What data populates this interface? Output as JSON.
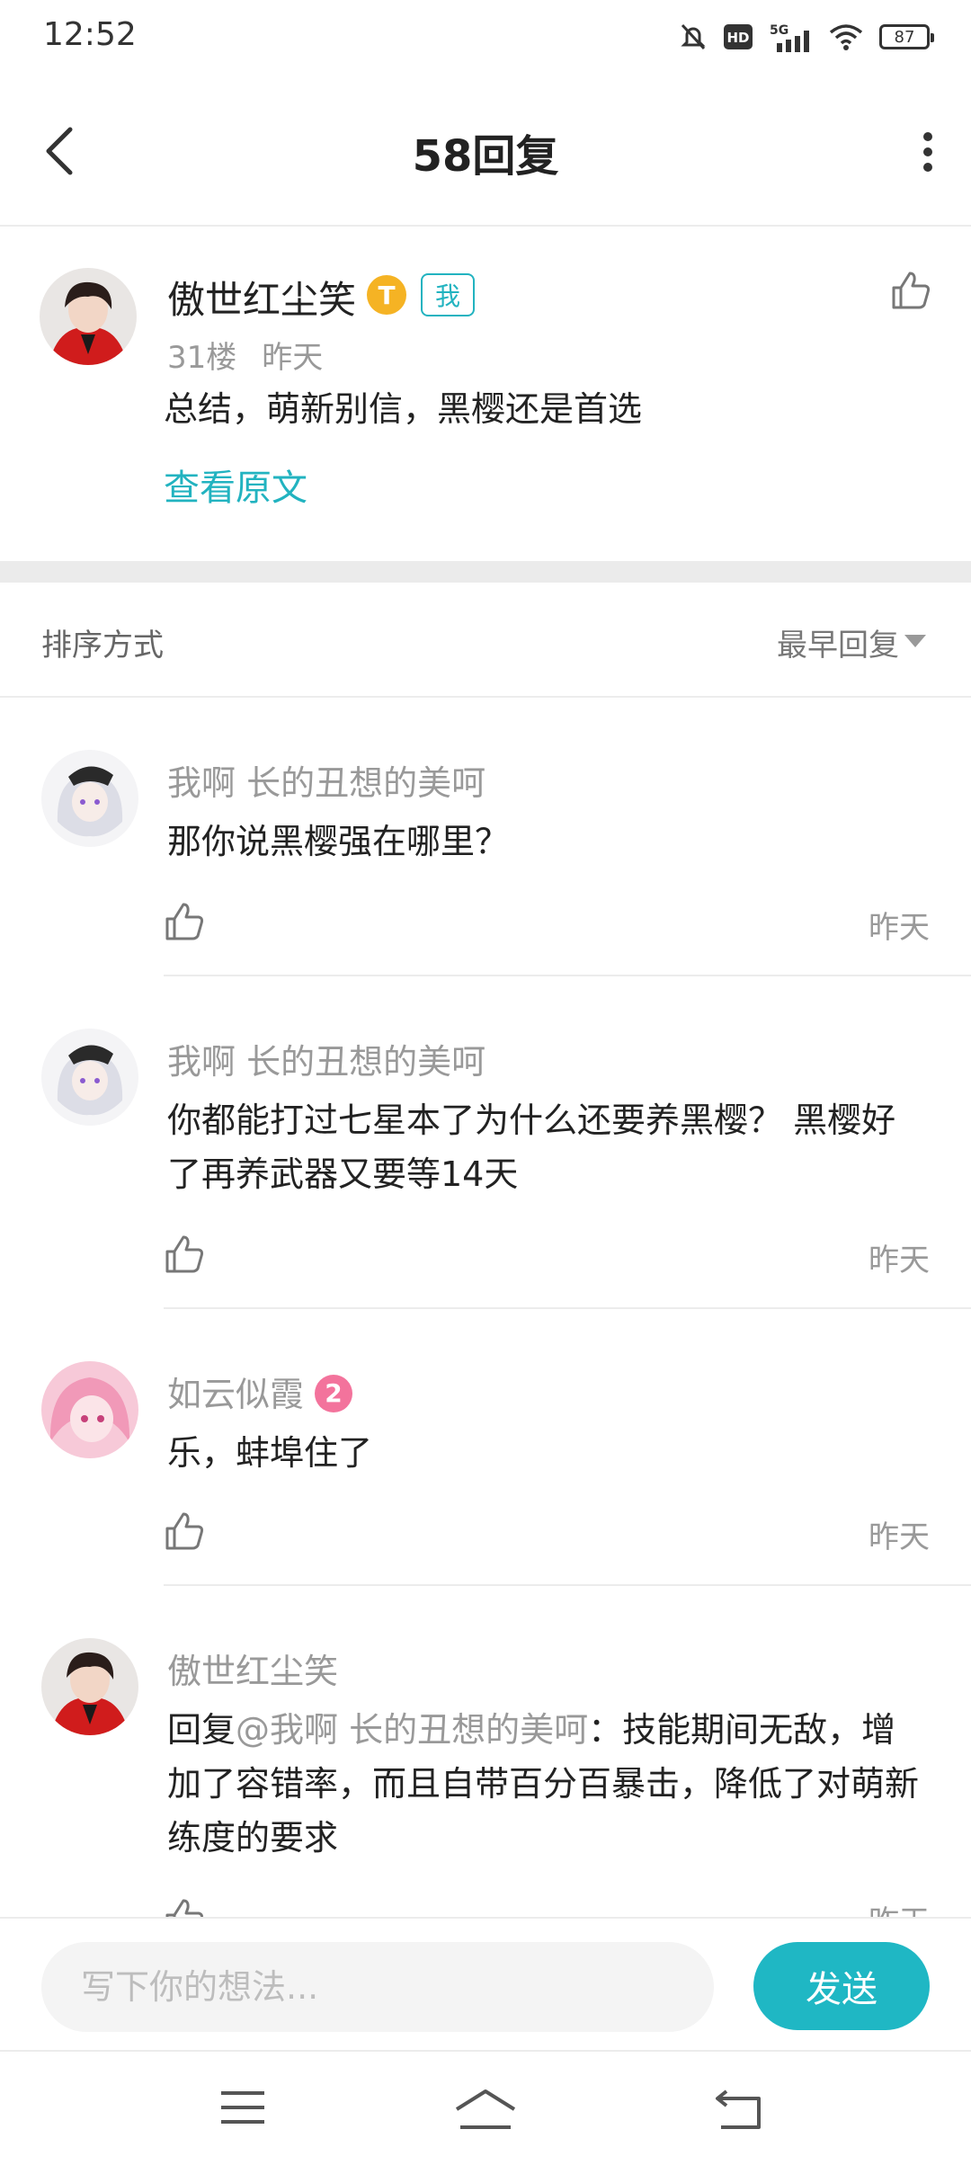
{
  "status_bar": {
    "time": "12:52",
    "network": "5G",
    "hd": "HD",
    "battery": "87"
  },
  "nav": {
    "title": "58回复"
  },
  "main_post": {
    "author": "傲世红尘笑",
    "title_badge": "T",
    "me_badge": "我",
    "floor": "31楼",
    "time": "昨天",
    "content": "总结，萌新别信，黑樱还是首选",
    "view_original": "查看原文"
  },
  "sort": {
    "label": "排序方式",
    "value": "最早回复"
  },
  "replies": [
    {
      "author": "我啊 长的丑想的美呵",
      "text": "那你说黑樱强在哪里？",
      "time": "昨天"
    },
    {
      "author": "我啊 长的丑想的美呵",
      "text": "你都能打过七星本了为什么还要养黑樱？  黑樱好了再养武器又要等14天",
      "time": "昨天"
    },
    {
      "author": "如云似霞",
      "level": "2",
      "text": "乐，蚌埠住了",
      "time": "昨天"
    },
    {
      "author": "傲世红尘笑",
      "reply_prefix": "回复",
      "mention": "@我啊 长的丑想的美呵",
      "text": "：技能期间无敌，增加了容错率，而且自带百分百暴击，降低了对萌新练度的要求",
      "time": "昨天"
    }
  ],
  "composer": {
    "placeholder": "写下你的想法...",
    "send_label": "发送"
  },
  "colors": {
    "accent": "#1fb7c4",
    "level_badge": "#f3739c",
    "title_badge": "#f5b324"
  }
}
